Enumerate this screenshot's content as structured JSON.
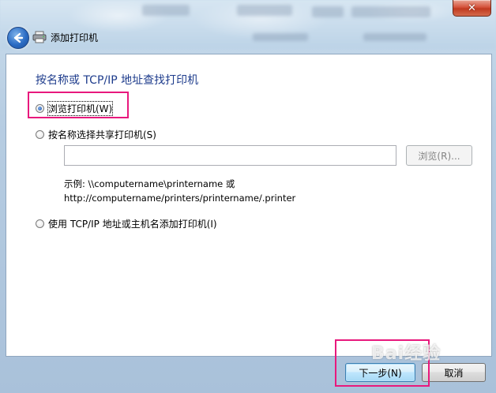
{
  "window": {
    "close_glyph": "✕",
    "title": "添加打印机"
  },
  "main": {
    "heading": "按名称或 TCP/IP 地址查找打印机",
    "options": [
      {
        "label": "浏览打印机(W)",
        "checked": true
      },
      {
        "label": "按名称选择共享打印机(S)",
        "checked": false
      },
      {
        "label": "使用 TCP/IP 地址或主机名添加打印机(I)",
        "checked": false
      }
    ],
    "share_input": {
      "value": "",
      "placeholder": ""
    },
    "browse_label": "浏览(R)...",
    "example_line1": "示例: \\\\computername\\printername 或",
    "example_line2": "http://computername/printers/printername/.printer"
  },
  "footer": {
    "next_label": "下一步(N)",
    "cancel_label": "取消"
  },
  "watermark": {
    "text": "Bai经验"
  },
  "colors": {
    "heading": "#1e3c8c",
    "highlight": "#e8197d",
    "close": "#c03a20"
  },
  "icons": {
    "back": "back-arrow-icon",
    "printer": "printer-icon",
    "close": "close-icon"
  }
}
